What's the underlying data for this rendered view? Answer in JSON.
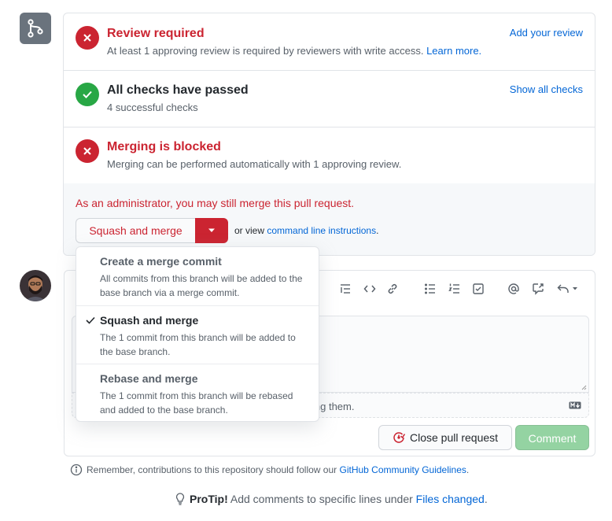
{
  "merge_box": {
    "review": {
      "title": "Review required",
      "desc": "At least 1 approving review is required by reviewers with write access.",
      "learn_more": "Learn more.",
      "action": "Add your review"
    },
    "checks": {
      "title": "All checks have passed",
      "desc": "4 successful checks",
      "action": "Show all checks"
    },
    "blocked": {
      "title": "Merging is blocked",
      "desc": "Merging can be performed automatically with 1 approving review."
    },
    "admin_text": "As an administrator, you may still merge this pull request.",
    "merge_button": "Squash and merge",
    "or_view": "or view",
    "command_line": "command line instructions",
    "period": "."
  },
  "dropdown": {
    "items": [
      {
        "title": "Create a merge commit",
        "desc": "All commits from this branch will be added to the base branch via a merge commit.",
        "selected": false
      },
      {
        "title": "Squash and merge",
        "desc": "The 1 commit from this branch will be added to the base branch.",
        "selected": true
      },
      {
        "title": "Rebase and merge",
        "desc": "The 1 commit from this branch will be rebased and added to the base branch.",
        "selected": false
      }
    ]
  },
  "comment": {
    "footer_partial": "ing them.",
    "close_button": "Close pull request",
    "comment_button": "Comment"
  },
  "reminder": {
    "text": "Remember, contributions to this repository should follow our",
    "link": "GitHub Community Guidelines",
    "period": "."
  },
  "protip": {
    "label": "ProTip!",
    "text": "Add comments to specific lines under",
    "link": "Files changed",
    "period": "."
  },
  "colors": {
    "danger": "#cb2431",
    "success": "#28a745",
    "link": "#0366d6",
    "comment_disabled": "#94d3a2"
  },
  "icons": [
    "git-merge-icon",
    "x-icon",
    "check-icon",
    "triangle-down-icon",
    "list-ordered-icon",
    "code-icon",
    "link-icon",
    "list-unordered-icon",
    "tasklist-icon",
    "mention-icon",
    "cross-reference-icon",
    "reply-icon",
    "markdown-icon",
    "issue-closed-icon",
    "info-icon",
    "light-bulb-icon"
  ]
}
